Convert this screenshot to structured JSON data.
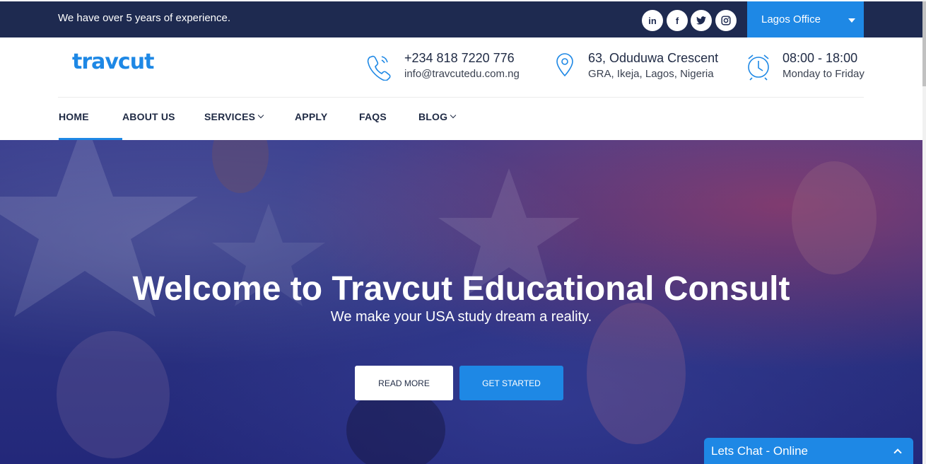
{
  "topbar": {
    "tagline": "We have over 5 years of experience.",
    "social": [
      {
        "name": "linkedin-icon",
        "glyph": "in"
      },
      {
        "name": "facebook-icon",
        "glyph": "f"
      },
      {
        "name": "twitter-icon",
        "glyph": "t"
      },
      {
        "name": "instagram-icon",
        "glyph": "ig"
      }
    ],
    "office_select": "Lagos Office"
  },
  "header": {
    "logo": "travcut",
    "contact": {
      "phone": "+234 818 7220 776",
      "email": "info@travcutedu.com.ng"
    },
    "address": {
      "line1": "63, Oduduwa Crescent",
      "line2": "GRA, Ikeja, Lagos, Nigeria"
    },
    "hours": {
      "line1": "08:00 - 18:00",
      "line2": "Monday to Friday"
    }
  },
  "nav": {
    "items": [
      {
        "label": "HOME",
        "active": true
      },
      {
        "label": "ABOUT US"
      },
      {
        "label": "SERVICES",
        "dropdown": true
      },
      {
        "label": "APPLY"
      },
      {
        "label": "FAQS"
      },
      {
        "label": "BLOG",
        "dropdown": true
      }
    ]
  },
  "hero": {
    "title": "Welcome to Travcut Educational Consult",
    "subtitle": "We make your USA study dream a reality.",
    "read_more": "READ MORE",
    "get_started": "GET STARTED"
  },
  "chat": {
    "label": "Lets Chat - Online"
  },
  "colors": {
    "primary": "#1e88e5",
    "dark": "#1e2a50",
    "text": "#1f2a44"
  }
}
